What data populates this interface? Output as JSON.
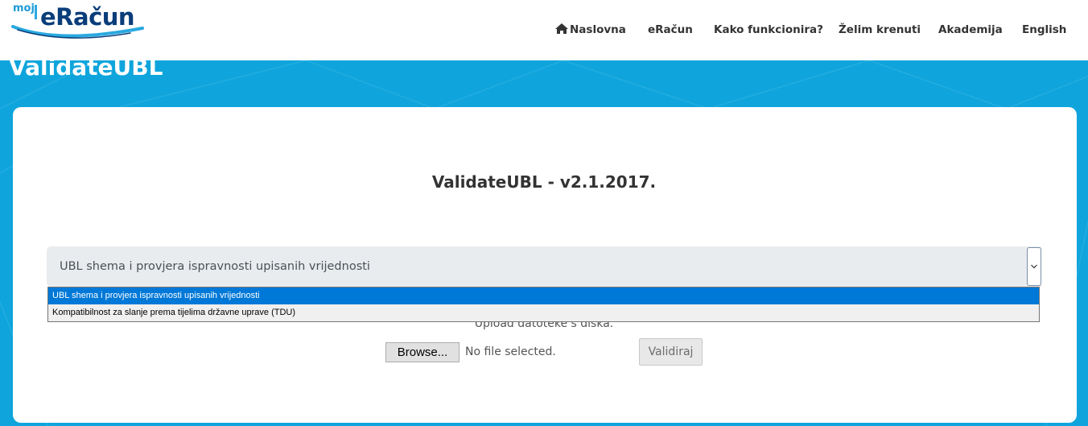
{
  "logo": {
    "prefix": "moj",
    "name": "eRačun"
  },
  "nav": {
    "items": [
      {
        "label": "Naslovna",
        "icon": "home-icon"
      },
      {
        "label": "eRačun"
      },
      {
        "label": "Kako funkcionira?"
      },
      {
        "label": "Želim krenuti"
      },
      {
        "label": "Akademija"
      },
      {
        "label": "English"
      }
    ]
  },
  "banner": {
    "title": "ValidateUBL"
  },
  "card": {
    "title": "ValidateUBL - v2.1.2017."
  },
  "validation_type": {
    "selected": "UBL shema i provjera ispravnosti upisanih vrijednosti",
    "options": [
      "UBL shema i provjera ispravnosti upisanih vrijednosti",
      "Kompatibilnost za slanje prema tijelima državne uprave (TDU)"
    ]
  },
  "upload": {
    "label": "Upload datoteke s diska.",
    "browse_label": "Browse...",
    "file_status": "No file selected.",
    "validate_label": "Validiraj"
  },
  "colors": {
    "banner": "#0fa5dc",
    "logo_text": "#0a3d7a",
    "selected_option": "#0078d7"
  }
}
